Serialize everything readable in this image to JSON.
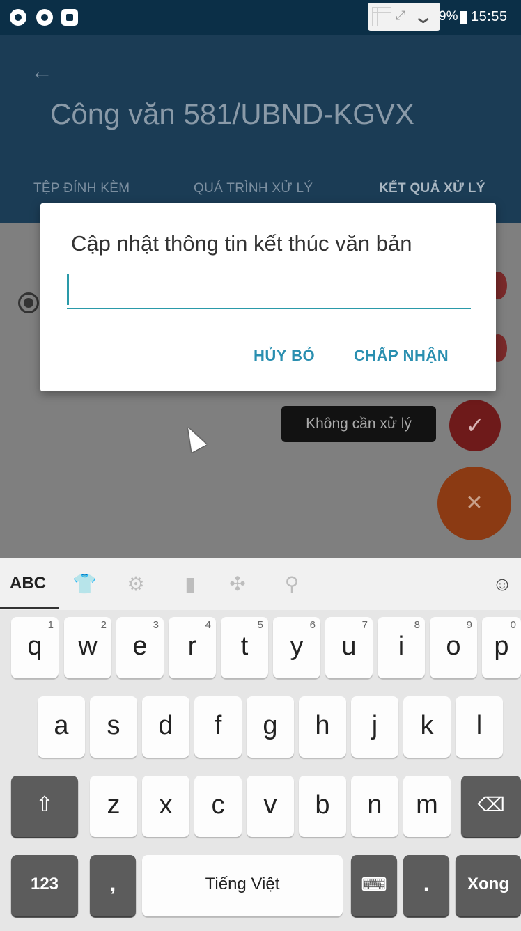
{
  "status_bar": {
    "battery_text": "9%",
    "time": "15:55",
    "icons": [
      "messenger-icon",
      "eye-icon",
      "sync-icon",
      "grid-icon",
      "expand-icon",
      "chevron-down-icon",
      "battery-icon"
    ]
  },
  "app_bar": {
    "back_icon": "back-arrow-icon",
    "title": "Công văn 581/UBND-KGVX",
    "tabs": [
      "TỆP ĐÍNH KÈM",
      "QUÁ TRÌNH XỬ LÝ",
      "KẾT QUẢ XỬ LÝ"
    ]
  },
  "background": {
    "tooltip": "Không cần xử lý"
  },
  "dialog": {
    "title": "Cập nhật thông tin kết thúc văn bản",
    "input_value": "",
    "cancel_label": "HỦY BỎ",
    "ok_label": "CHẤP NHẬN"
  },
  "keyboard": {
    "mode_label": "ABC",
    "toolbar_icons": [
      "shirt-icon",
      "gear-icon",
      "sticker-icon",
      "move-cursor-icon",
      "search-icon",
      "emoji-icon"
    ],
    "row1": [
      {
        "ch": "q",
        "num": "1"
      },
      {
        "ch": "w",
        "num": "2"
      },
      {
        "ch": "e",
        "num": "3"
      },
      {
        "ch": "r",
        "num": "4"
      },
      {
        "ch": "t",
        "num": "5"
      },
      {
        "ch": "y",
        "num": "6"
      },
      {
        "ch": "u",
        "num": "7"
      },
      {
        "ch": "i",
        "num": "8"
      },
      {
        "ch": "o",
        "num": "9"
      },
      {
        "ch": "p",
        "num": "0"
      }
    ],
    "row2": [
      "a",
      "s",
      "d",
      "f",
      "g",
      "h",
      "j",
      "k",
      "l"
    ],
    "row3": [
      "z",
      "x",
      "c",
      "v",
      "b",
      "n",
      "m"
    ],
    "num_key": "123",
    "comma_key": ",",
    "space_label": "Tiếng Việt",
    "period_key": ".",
    "done_label": "Xong"
  },
  "colors": {
    "accent": "#2a9aa9",
    "dialog_button": "#2a8fb0",
    "app_bar_dim": "#1b3c55",
    "status_bar": "#0b2f47"
  }
}
